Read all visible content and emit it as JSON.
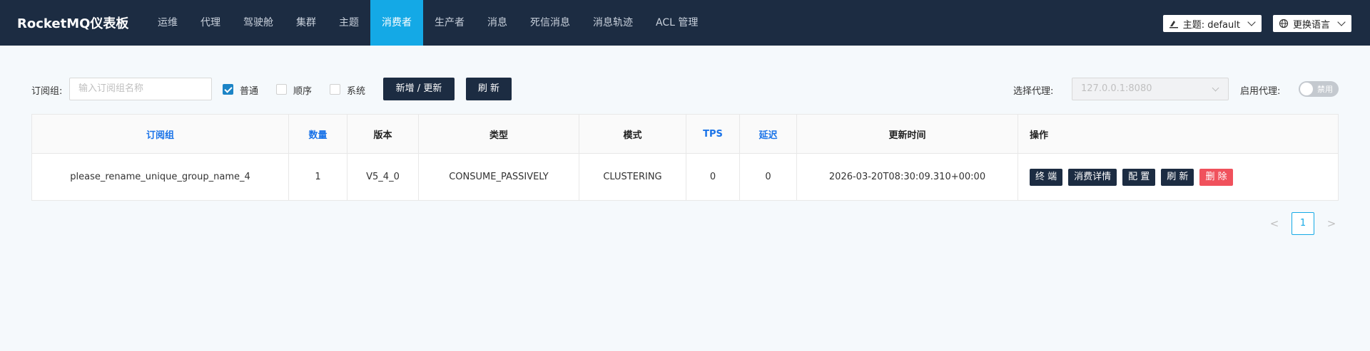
{
  "app": {
    "brand": "RocketMQ仪表板"
  },
  "nav": {
    "items": [
      {
        "label": "运维"
      },
      {
        "label": "代理"
      },
      {
        "label": "驾驶舱"
      },
      {
        "label": "集群"
      },
      {
        "label": "主题"
      },
      {
        "label": "消费者"
      },
      {
        "label": "生产者"
      },
      {
        "label": "消息"
      },
      {
        "label": "死信消息"
      },
      {
        "label": "消息轨迹"
      },
      {
        "label": "ACL 管理"
      }
    ],
    "active": "消费者",
    "theme_label": "主题: default",
    "language_label": "更换语言"
  },
  "toolbar": {
    "group_label": "订阅组:",
    "group_placeholder": "输入订阅组名称",
    "cb_normal": "普通",
    "cb_normal_checked": true,
    "cb_order": "顺序",
    "cb_order_checked": false,
    "cb_system": "系统",
    "cb_system_checked": false,
    "add_update": "新增 / 更新",
    "refresh": "刷 新",
    "proxy_label": "选择代理:",
    "proxy_value": "127.0.0.1:8080",
    "enable_proxy_label": "启用代理:",
    "toggle_label": "禁用"
  },
  "table": {
    "headers": [
      {
        "label": "订阅组",
        "sortable": true
      },
      {
        "label": "数量",
        "sortable": true
      },
      {
        "label": "版本",
        "sortable": false
      },
      {
        "label": "类型",
        "sortable": false
      },
      {
        "label": "模式",
        "sortable": false
      },
      {
        "label": "TPS",
        "sortable": true
      },
      {
        "label": "延迟",
        "sortable": true
      },
      {
        "label": "更新时间",
        "sortable": false
      },
      {
        "label": "操作",
        "sortable": false
      }
    ],
    "rows": [
      {
        "group": "please_rename_unique_group_name_4",
        "count": "1",
        "version": "V5_4_0",
        "type": "CONSUME_PASSIVELY",
        "mode": "CLUSTERING",
        "tps": "0",
        "delay": "0",
        "update_time": "2026-03-20T08:30:09.310+00:00",
        "ops": {
          "terminal": "终 端",
          "detail": "消费详情",
          "config": "配 置",
          "refresh": "刷 新",
          "delete": "删 除"
        }
      }
    ]
  },
  "pagination": {
    "current": "1",
    "prev": "<",
    "next": ">"
  }
}
